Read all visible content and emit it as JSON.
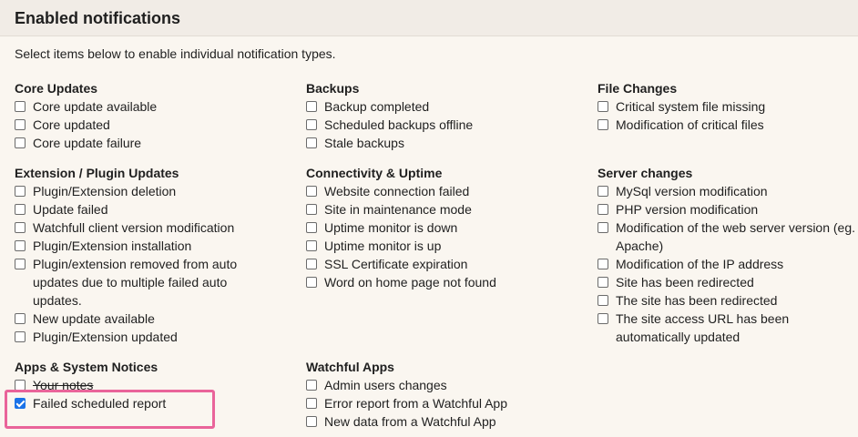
{
  "panel": {
    "title": "Enabled notifications",
    "intro": "Select items below to enable individual notification types."
  },
  "groups": {
    "core": {
      "title": "Core Updates",
      "items": [
        "Core update available",
        "Core updated",
        "Core update failure"
      ]
    },
    "extensions": {
      "title": "Extension / Plugin Updates",
      "items": [
        "Plugin/Extension deletion",
        "Update failed",
        "Watchfull client version modification",
        "Plugin/Extension installation",
        "Plugin/extension removed from auto updates due to multiple failed auto updates.",
        "New update available",
        "Plugin/Extension updated"
      ]
    },
    "apps_system": {
      "title": "Apps & System Notices",
      "items": [
        "Your notes",
        "Failed scheduled report"
      ],
      "checked": [
        false,
        true
      ]
    },
    "backups": {
      "title": "Backups",
      "items": [
        "Backup completed",
        "Scheduled backups offline",
        "Stale backups"
      ]
    },
    "connectivity": {
      "title": "Connectivity & Uptime",
      "items": [
        "Website connection failed",
        "Site in maintenance mode",
        "Uptime monitor is down",
        "Uptime monitor is up",
        "SSL Certificate expiration",
        "Word on home page not found"
      ]
    },
    "watchful_apps": {
      "title": "Watchful Apps",
      "items": [
        "Admin users changes",
        "Error report from a Watchful App",
        "New data from a Watchful App"
      ]
    },
    "file_changes": {
      "title": "File Changes",
      "items": [
        "Critical system file missing",
        "Modification of critical files"
      ]
    },
    "server_changes": {
      "title": "Server changes",
      "items": [
        "MySql version modification",
        "PHP version modification",
        "Modification of the web server version (eg. Apache)",
        "Modification of the IP address",
        "Site has been redirected",
        "The site has been redirected",
        "The site access URL has been automatically updated"
      ]
    }
  },
  "colors": {
    "checkbox_checked": "#1a73e8",
    "highlight_border": "#e9649a"
  }
}
